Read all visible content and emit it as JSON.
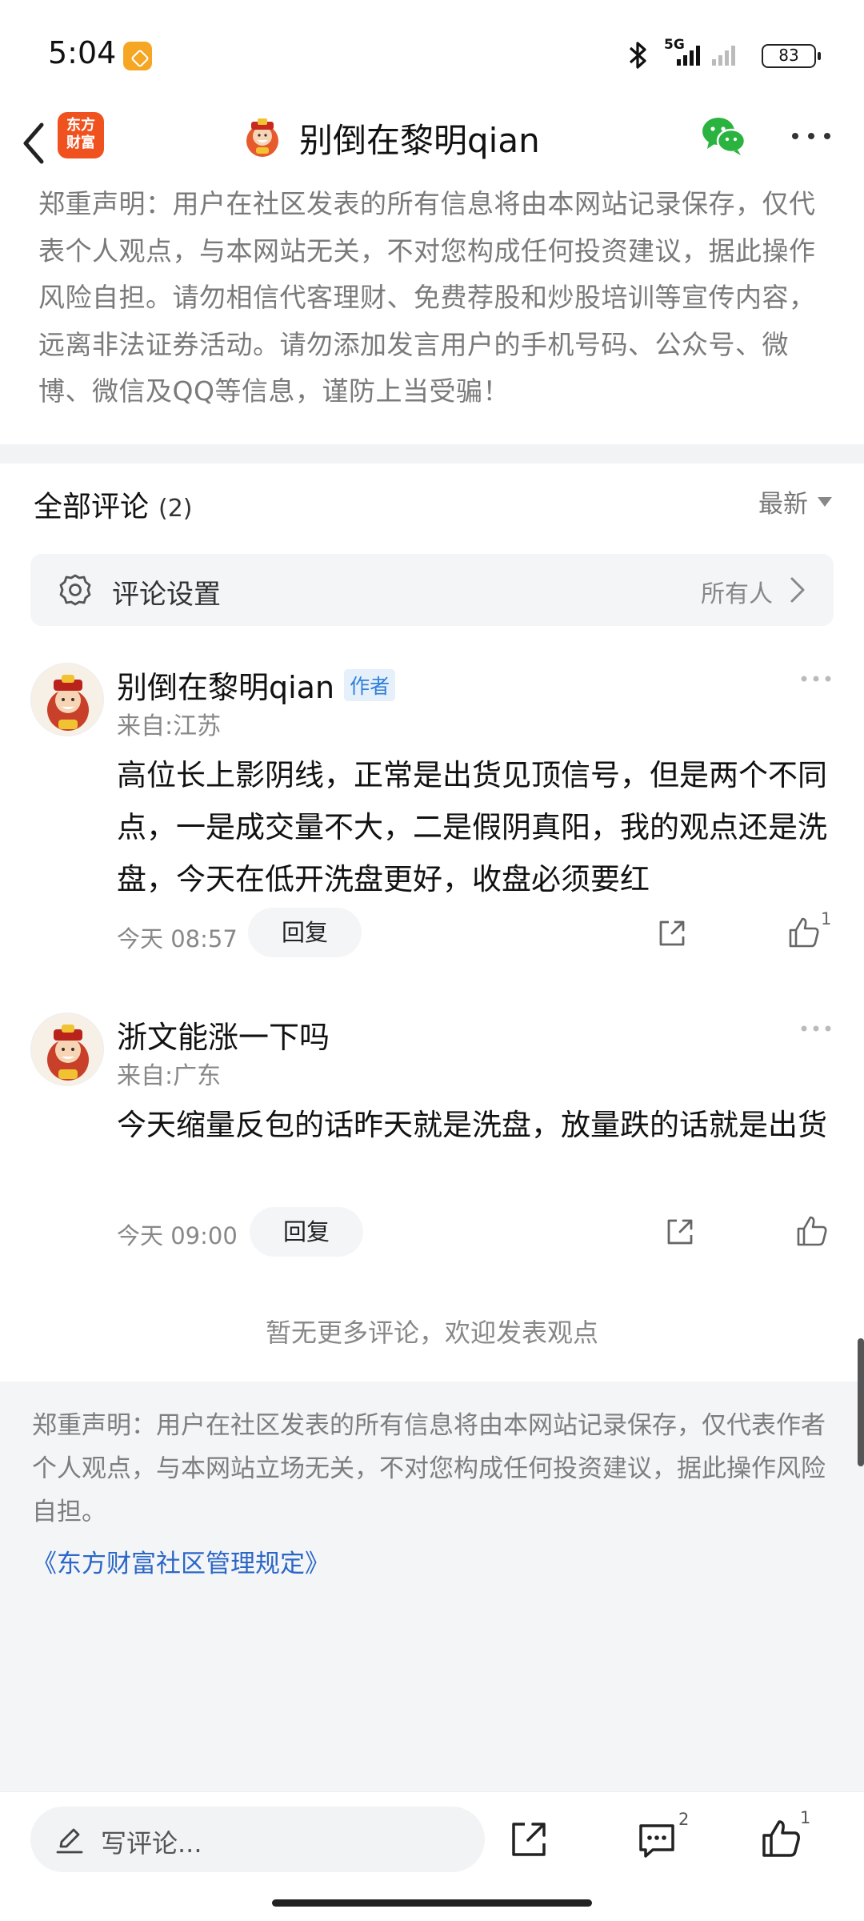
{
  "status_bar": {
    "time": "5:04",
    "network": "5G",
    "battery": "83"
  },
  "header": {
    "brand_logo_text": "东方财富",
    "title": "别倒在黎明qian"
  },
  "disclaimer_top": "郑重声明：用户在社区发表的所有信息将由本网站记录保存，仅代表个人观点，与本网站无关，不对您构成任何投资建议，据此操作风险自担。请勿相信代客理财、免费荐股和炒股培训等宣传内容，远离非法证券活动。请勿添加发言用户的手机号码、公众号、微博、微信及QQ等信息，谨防上当受骗！",
  "comments_section": {
    "title": "全部评论",
    "count": "(2)",
    "sort_label": "最新",
    "settings_label": "评论设置",
    "settings_value": "所有人"
  },
  "comments": [
    {
      "name": "别倒在黎明qian",
      "badge": "作者",
      "location": "来自:江苏",
      "text": "高位长上影阴线，正常是出货见顶信号，但是两个不同点，一是成交量不大，二是假阴真阳，我的观点还是洗盘，今天在低开洗盘更好，收盘必须要红",
      "time": "今天 08:57",
      "reply_label": "回复",
      "like_count": "1"
    },
    {
      "name": "浙文能涨一下吗",
      "location": "来自:广东",
      "text": "今天缩量反包的话昨天就是洗盘，放量跌的话就是出货",
      "time": "今天 09:00",
      "reply_label": "回复"
    }
  ],
  "no_more_text": "暂无更多评论，欢迎发表观点",
  "disclaimer_bottom": "郑重声明：用户在社区发表的所有信息将由本网站记录保存，仅代表作者个人观点，与本网站立场无关，不对您构成任何投资建议，据此操作风险自担。",
  "rules_link": "《东方财富社区管理规定》",
  "toolbar": {
    "input_placeholder": "写评论...",
    "comment_count": "2",
    "like_count": "1"
  },
  "colors": {
    "brand": "#f0521f",
    "wechat": "#2ab33f",
    "link": "#2b67c7",
    "badge": "#2f7fd8"
  },
  "icons": [
    "chevron-left-icon",
    "wechat-icon",
    "more-dots-icon",
    "gear-icon",
    "chevron-right-icon",
    "share-icon",
    "thumb-up-icon",
    "pencil-icon",
    "comment-bubble-icon",
    "bluetooth-icon",
    "signal-icon",
    "battery-icon"
  ]
}
